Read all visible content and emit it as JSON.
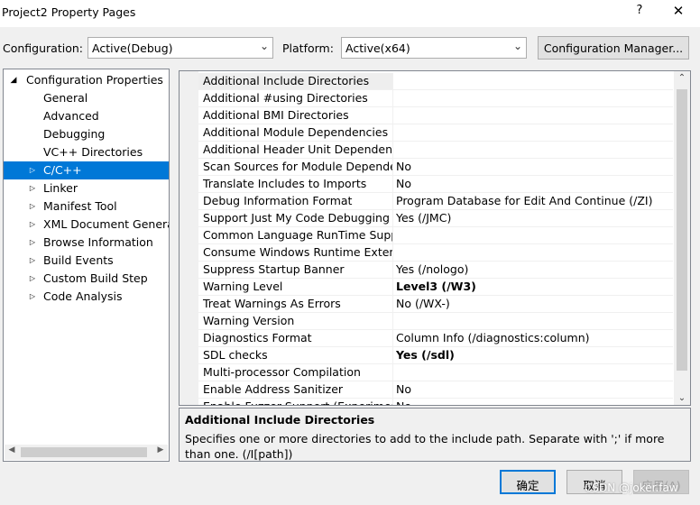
{
  "window": {
    "title": "Project2 Property Pages",
    "help": "?",
    "close": "✕"
  },
  "configuration": {
    "label": "Configuration:",
    "value": "Active(Debug)"
  },
  "platform": {
    "label": "Platform:",
    "value": "Active(x64)"
  },
  "config_manager_label": "Configuration Manager...",
  "tree": {
    "root": "Configuration Properties",
    "items": [
      {
        "label": "General"
      },
      {
        "label": "Advanced"
      },
      {
        "label": "Debugging"
      },
      {
        "label": "VC++ Directories"
      },
      {
        "label": "C/C++"
      },
      {
        "label": "Linker"
      },
      {
        "label": "Manifest Tool"
      },
      {
        "label": "XML Document Generat"
      },
      {
        "label": "Browse Information"
      },
      {
        "label": "Build Events"
      },
      {
        "label": "Custom Build Step"
      },
      {
        "label": "Code Analysis"
      }
    ],
    "selected": "C/C++"
  },
  "properties": [
    {
      "name": "Additional Include Directories",
      "value": ""
    },
    {
      "name": "Additional #using Directories",
      "value": ""
    },
    {
      "name": "Additional BMI Directories",
      "value": ""
    },
    {
      "name": "Additional Module Dependencies",
      "value": ""
    },
    {
      "name": "Additional Header Unit Dependencie",
      "value": ""
    },
    {
      "name": "Scan Sources for Module Dependen",
      "value": "No"
    },
    {
      "name": "Translate Includes to Imports",
      "value": "No"
    },
    {
      "name": "Debug Information Format",
      "value": "Program Database for Edit And Continue (/ZI)"
    },
    {
      "name": "Support Just My Code Debugging",
      "value": "Yes (/JMC)"
    },
    {
      "name": "Common Language RunTime Suppo",
      "value": ""
    },
    {
      "name": "Consume Windows Runtime Extensio",
      "value": ""
    },
    {
      "name": "Suppress Startup Banner",
      "value": "Yes (/nologo)"
    },
    {
      "name": "Warning Level",
      "value": "Level3 (/W3)"
    },
    {
      "name": "Treat Warnings As Errors",
      "value": "No (/WX-)"
    },
    {
      "name": "Warning Version",
      "value": ""
    },
    {
      "name": "Diagnostics Format",
      "value": "Column Info (/diagnostics:column)"
    },
    {
      "name": "SDL checks",
      "value": "Yes (/sdl)"
    },
    {
      "name": "Multi-processor Compilation",
      "value": ""
    },
    {
      "name": "Enable Address Sanitizer",
      "value": "No"
    },
    {
      "name": "Enable Fuzzer Support (Experiment",
      "value": "No"
    }
  ],
  "description": {
    "title": "Additional Include Directories",
    "text": "Specifies one or more directories to add to the include path. Separate with ';' if more than one.     (/I[path])"
  },
  "buttons": {
    "ok": "确定",
    "cancel": "取消",
    "apply": "应用(A)"
  },
  "watermark": "CSDN @joker.faw",
  "colors": {
    "selection": "#0078d7",
    "background": "#f0f0f0"
  }
}
